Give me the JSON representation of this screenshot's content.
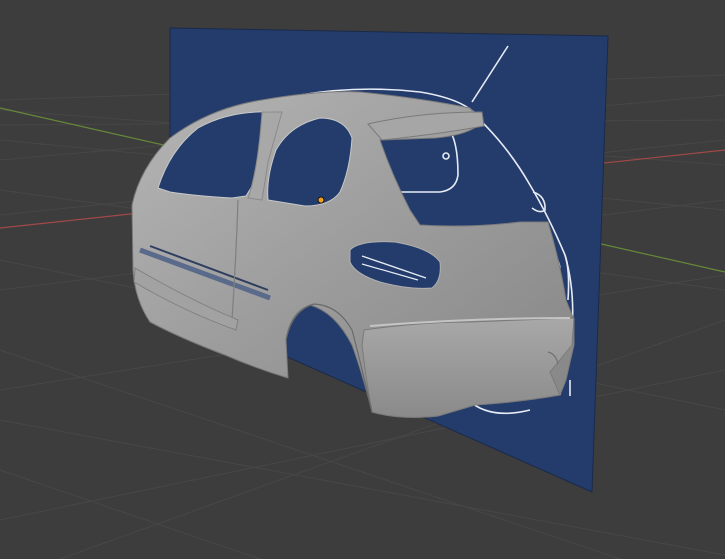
{
  "viewport": {
    "name": "3D Viewport",
    "background_color": "#3d3d3d",
    "grid_color": "#4a4a4a",
    "x_axis_color": "#b54a4a",
    "y_axis_color": "#6f9b3a"
  },
  "scene": {
    "objects": [
      {
        "name": "reference-blueprint-plane",
        "color": "#243c6c",
        "type": "image-plane"
      },
      {
        "name": "car-body-mesh",
        "color": "#9a9a9a",
        "type": "mesh"
      }
    ],
    "blueprint_line_color": "#e6ebf5",
    "origin_point_color": "#f0a020"
  }
}
